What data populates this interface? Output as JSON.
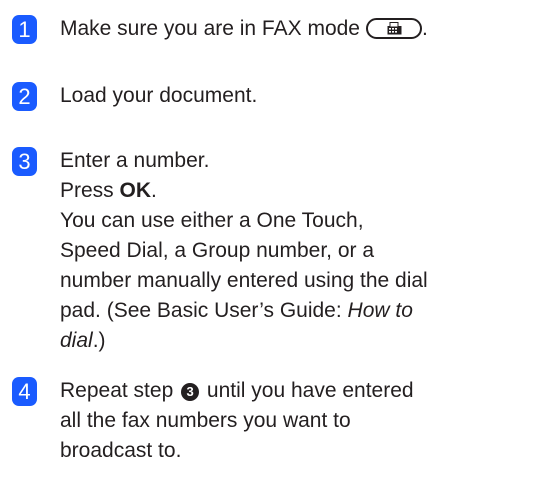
{
  "steps": [
    {
      "number": "1",
      "text": "Make sure you are in FAX mode",
      "trailing": ".",
      "icon": "fax-mode-key-icon"
    },
    {
      "number": "2",
      "text": "Load your document."
    },
    {
      "number": "3",
      "lines": {
        "line1": "Enter a number.",
        "press_prefix": "Press ",
        "press_key": "OK",
        "press_suffix": ".",
        "line3": "You can use either a One Touch,",
        "line4": "Speed Dial, a Group number, or a",
        "line5": "number manually entered using the dial",
        "line6_prefix": "pad. (See Basic User’s Guide: ",
        "line6_italic": "How to",
        "line7_italic": "dial",
        "line7_suffix": ".)"
      }
    },
    {
      "number": "4",
      "lines": {
        "line1_prefix": "Repeat step ",
        "step_ref": "3",
        "line1_suffix": " until you have entered",
        "line2": "all the fax numbers you want to",
        "line3": "broadcast to."
      }
    }
  ],
  "colors": {
    "badge": "#1a5bff",
    "text": "#231f20"
  }
}
